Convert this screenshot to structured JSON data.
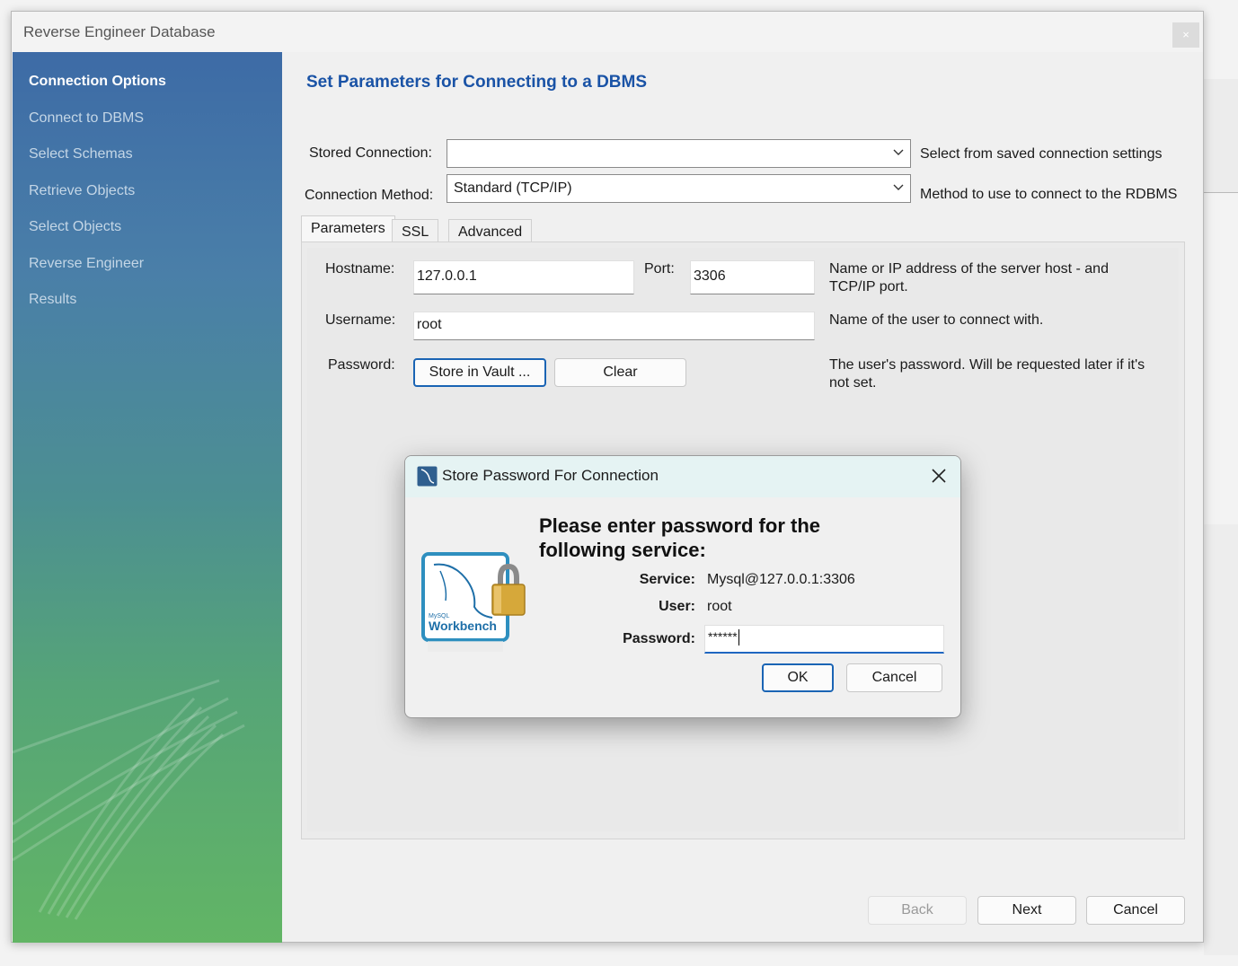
{
  "window": {
    "title": "Reverse Engineer Database",
    "close_label": "×"
  },
  "sidebar": {
    "steps": [
      {
        "label": "Connection Options",
        "active": true
      },
      {
        "label": "Connect to DBMS",
        "active": false
      },
      {
        "label": "Select Schemas",
        "active": false
      },
      {
        "label": "Retrieve Objects",
        "active": false
      },
      {
        "label": "Select Objects",
        "active": false
      },
      {
        "label": "Reverse Engineer",
        "active": false
      },
      {
        "label": "Results",
        "active": false
      }
    ]
  },
  "main": {
    "heading": "Set Parameters for Connecting to a DBMS",
    "stored_connection": {
      "label": "Stored Connection:",
      "value": "",
      "hint": "Select from saved connection settings"
    },
    "connection_method": {
      "label": "Connection Method:",
      "value": "Standard (TCP/IP)",
      "hint": "Method to use to connect to the RDBMS"
    },
    "tabs": [
      {
        "label": "Parameters",
        "active": true
      },
      {
        "label": "SSL",
        "active": false
      },
      {
        "label": "Advanced",
        "active": false
      }
    ],
    "parameters": {
      "hostname_label": "Hostname:",
      "hostname_value": "127.0.0.1",
      "port_label": "Port:",
      "port_value": "3306",
      "host_hint_line1": "Name or IP address of the server host - and",
      "host_hint_line2": "TCP/IP port.",
      "username_label": "Username:",
      "username_value": "root",
      "username_hint": "Name of the user to connect with.",
      "password_label": "Password:",
      "store_vault_label": "Store in Vault ...",
      "clear_label": "Clear",
      "password_hint_line1": "The user's password. Will be requested later if it's",
      "password_hint_line2": "not set."
    }
  },
  "footer": {
    "back_label": "Back",
    "next_label": "Next",
    "cancel_label": "Cancel"
  },
  "dialog": {
    "title": "Store Password For Connection",
    "prompt_line1": "Please enter password for the",
    "prompt_line2": "following service:",
    "service_label": "Service:",
    "service_value": "Mysql@127.0.0.1:3306",
    "user_label": "User:",
    "user_value": "root",
    "password_label": "Password:",
    "password_value": "******",
    "ok_label": "OK",
    "cancel_label": "Cancel",
    "logo_text_small": "MySQL",
    "logo_text": "Workbench"
  },
  "colors": {
    "heading": "#1a53a6",
    "sidebar_top": "#3d6ba6",
    "sidebar_bottom": "#62b565",
    "focus_blue": "#1f66c1"
  }
}
